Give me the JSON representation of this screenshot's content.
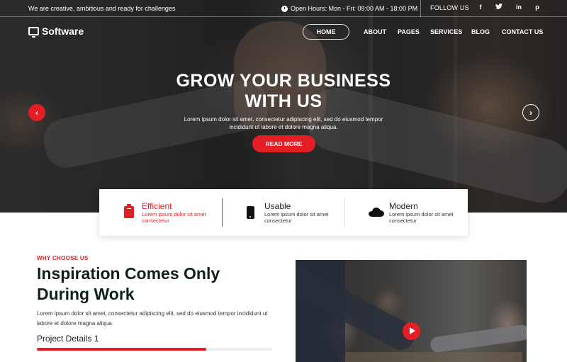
{
  "topbar": {
    "tagline": "We are creative, ambitious and ready for challenges",
    "hours": "Open Hours: Mon - Fri: 09:00 AM - 18:00 PM",
    "follow_label": "FOLLOW US",
    "social": [
      {
        "name": "facebook",
        "glyph": "f"
      },
      {
        "name": "twitter",
        "glyph": "t"
      },
      {
        "name": "linkedin",
        "glyph": "in"
      },
      {
        "name": "pinterest",
        "glyph": "p"
      }
    ]
  },
  "brand": {
    "name": "Software",
    "icon": "monitor-icon"
  },
  "nav": {
    "items": [
      "HOME",
      "ABOUT",
      "PAGES",
      "SERVICES",
      "BLOG",
      "CONTACT US"
    ],
    "active": "HOME"
  },
  "hero": {
    "title_line1": "GROW YOUR BUSINESS",
    "title_line2": "WITH US",
    "subtitle": "Lorem ipsum dolor sit amet, consectetur adipiscing elit, sed do eiusmod tempor incididunt ut labore et dolore magna aliqua.",
    "cta": "READ MORE",
    "prev_glyph": "‹",
    "next_glyph": "›"
  },
  "features": [
    {
      "title": "Efficient",
      "desc": "Lorem ipsum dolor sit amet consectetur",
      "icon": "clipboard-icon",
      "active": true
    },
    {
      "title": "Usable",
      "desc": "Lorem ipsum dolor sit amet consectetur",
      "icon": "phone-icon",
      "active": false
    },
    {
      "title": "Modern",
      "desc": "Lorem ipsum dolor sit amet consectetur",
      "icon": "cloud-icon",
      "active": false
    }
  ],
  "why": {
    "label": "WHY CHOOSE US",
    "title": "Inspiration Comes Only During Work",
    "text": "Lorem ipsum dolor sit amet, consectetur adipiscing elit, sed do eiusmod tempor incididunt ut labore et dolore magna aliqua.",
    "project_label": "Project Details 1",
    "project_progress_percent": 72
  },
  "colors": {
    "accent": "#e31e24",
    "heading": "#0f1f1f",
    "text": "#333333"
  }
}
